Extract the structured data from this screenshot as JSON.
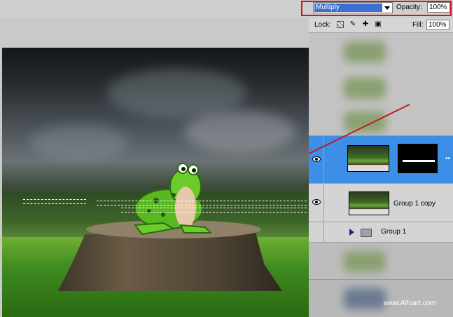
{
  "options_bar": {
    "blend_mode": "Multiply",
    "opacity_label": "Opacity:",
    "opacity_value": "100%"
  },
  "lock_bar": {
    "lock_label": "Lock:",
    "fill_label": "Fill:",
    "fill_value": "100%"
  },
  "layers": [
    {
      "name": "",
      "selected": true,
      "visible": true,
      "has_mask": true
    },
    {
      "name": "Group 1 copy",
      "selected": false,
      "visible": true,
      "has_mask": false
    },
    {
      "name": "Group 1",
      "selected": false,
      "visible": false,
      "is_group": true
    }
  ],
  "icons": [
    "eye-icon",
    "lock-transparent-icon",
    "lock-brush-icon",
    "lock-move-icon",
    "lock-all-icon",
    "folder-icon",
    "disclosure-triangle-icon"
  ],
  "colors": {
    "highlight": "#d0151d",
    "selection_blue": "#3c8ee6",
    "blend_select": "#3c6fd1"
  },
  "watermark": "www.Alfoart.com"
}
